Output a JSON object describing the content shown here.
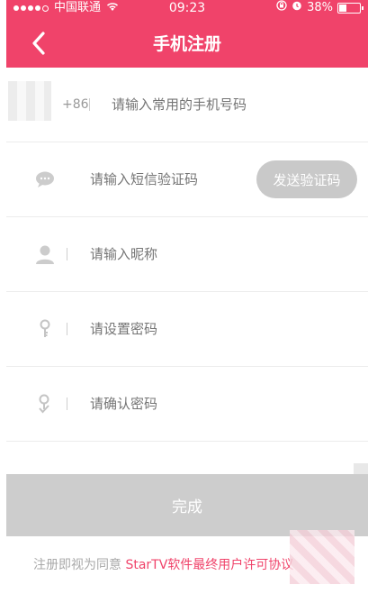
{
  "status_bar": {
    "carrier": "中国联通",
    "time": "09:23",
    "battery": "38%",
    "battery_level": 0.38
  },
  "header": {
    "title": "手机注册",
    "background": "#f0436a"
  },
  "form": {
    "phone": {
      "prefix": "+86",
      "placeholder": "请输入常用的手机号码"
    },
    "sms": {
      "placeholder": "请输入短信验证码",
      "button_label": "发送验证码"
    },
    "nickname": {
      "placeholder": "请输入昵称"
    },
    "password": {
      "placeholder": "请设置密码"
    },
    "confirm_password": {
      "placeholder": "请确认密码"
    }
  },
  "submit_label": "完成",
  "agreement": {
    "text": "注册即视为同意",
    "link": "StarTV软件最终用户许可协议"
  },
  "colors": {
    "accent": "#f0436a",
    "disabled": "#cdcdcd"
  }
}
